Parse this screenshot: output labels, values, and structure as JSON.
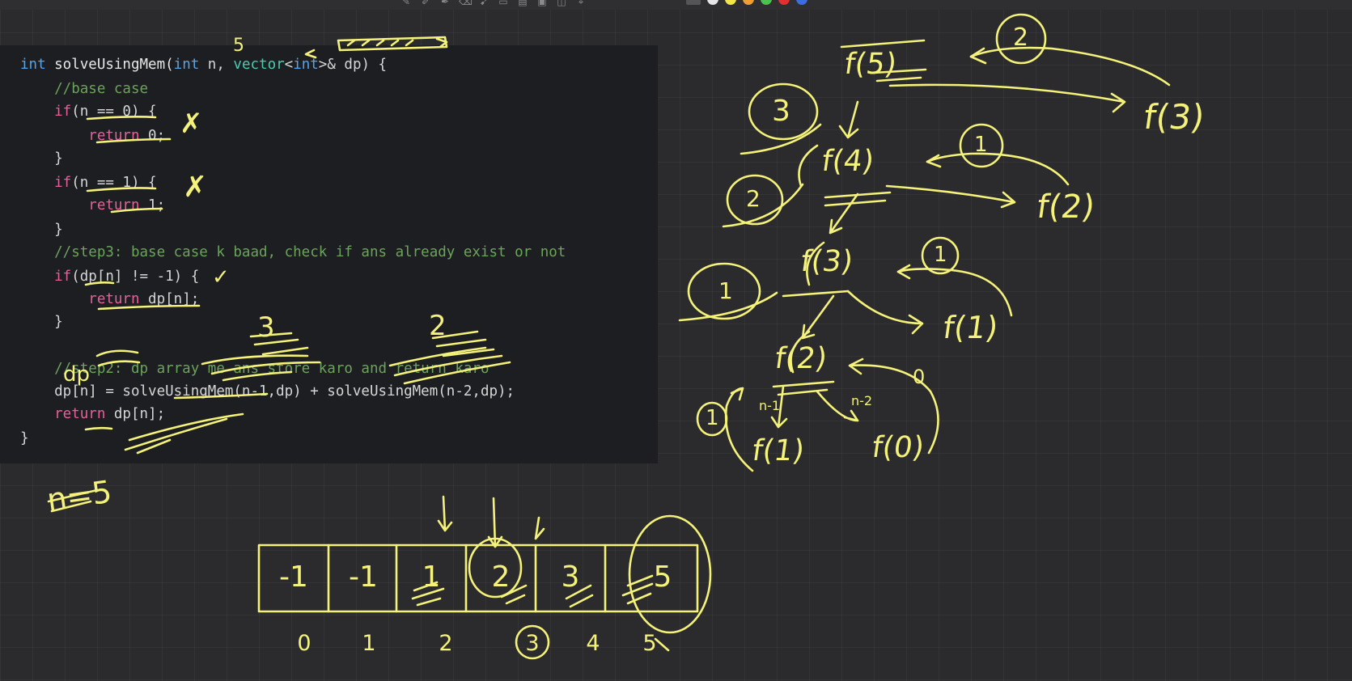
{
  "code": {
    "lines": [
      {
        "parts": [
          {
            "cls": "kw",
            "t": "int"
          },
          {
            "cls": "fn",
            "t": " solveUsingMem("
          },
          {
            "cls": "kw",
            "t": "int"
          },
          {
            "cls": "punc",
            "t": " n, "
          },
          {
            "cls": "typ",
            "t": "vector"
          },
          {
            "cls": "punc",
            "t": "<"
          },
          {
            "cls": "kw",
            "t": "int"
          },
          {
            "cls": "punc",
            "t": ">& dp) {"
          }
        ]
      },
      {
        "parts": [
          {
            "cls": "cm",
            "t": "    //base case"
          }
        ]
      },
      {
        "parts": [
          {
            "cls": "kw2",
            "t": "    if"
          },
          {
            "cls": "punc",
            "t": "(n == 0) {"
          }
        ]
      },
      {
        "parts": [
          {
            "cls": "kw2",
            "t": "        return"
          },
          {
            "cls": "punc",
            "t": " 0;"
          }
        ]
      },
      {
        "parts": [
          {
            "cls": "punc",
            "t": "    }"
          }
        ]
      },
      {
        "parts": [
          {
            "cls": "kw2",
            "t": "    if"
          },
          {
            "cls": "punc",
            "t": "(n == 1) {"
          }
        ]
      },
      {
        "parts": [
          {
            "cls": "kw2",
            "t": "        return"
          },
          {
            "cls": "punc",
            "t": " 1;"
          }
        ]
      },
      {
        "parts": [
          {
            "cls": "punc",
            "t": "    }"
          }
        ]
      },
      {
        "parts": [
          {
            "cls": "cm",
            "t": "    //step3: base case k baad, check if ans already exist or not"
          }
        ]
      },
      {
        "parts": [
          {
            "cls": "kw2",
            "t": "    if"
          },
          {
            "cls": "punc",
            "t": "(dp[n] != -1) {"
          }
        ]
      },
      {
        "parts": [
          {
            "cls": "kw2",
            "t": "        return"
          },
          {
            "cls": "punc",
            "t": " dp[n];"
          }
        ]
      },
      {
        "parts": [
          {
            "cls": "punc",
            "t": "    }"
          }
        ]
      },
      {
        "parts": [
          {
            "cls": "punc",
            "t": ""
          }
        ]
      },
      {
        "parts": [
          {
            "cls": "cm",
            "t": "    //step2: dp array me ans store karo and return karo"
          }
        ]
      },
      {
        "parts": [
          {
            "cls": "punc",
            "t": "    dp[n] = solveUsingMem(n-1,dp) + solveUsingMem(n-2,dp);"
          }
        ]
      },
      {
        "parts": [
          {
            "cls": "kw2",
            "t": "    return"
          },
          {
            "cls": "punc",
            "t": " dp[n];"
          }
        ]
      },
      {
        "parts": [
          {
            "cls": "punc",
            "t": "}"
          }
        ]
      }
    ]
  },
  "annotations": {
    "n_label": "n=5",
    "param_note": "5",
    "dp_note": "dp",
    "crosses": [
      "✗",
      "✗"
    ],
    "check": "✓",
    "scribble_values": [
      "3",
      "2"
    ]
  },
  "tree": {
    "calls": [
      {
        "label": "f(5)",
        "name": "call-f5"
      },
      {
        "label": "f(4)",
        "name": "call-f4"
      },
      {
        "label": "f(3)",
        "name": "call-f3"
      },
      {
        "label": "f(2)",
        "name": "call-f2"
      },
      {
        "label": "f(1)",
        "name": "call-f1-left"
      },
      {
        "label": "f(0)",
        "name": "call-f0"
      },
      {
        "label": "f(3)",
        "name": "call-f3-right"
      },
      {
        "label": "f(2)",
        "name": "call-f2-right"
      },
      {
        "label": "f(1)",
        "name": "call-f1-right"
      }
    ],
    "returned_values": [
      "3",
      "2",
      "1",
      "1",
      "2",
      "1",
      "1",
      "0"
    ],
    "edge_labels": [
      "n-1",
      "n-2"
    ]
  },
  "dp_array": {
    "cells": [
      "-1",
      "-1",
      "1",
      "2",
      "3",
      "5"
    ],
    "indices": [
      "0",
      "1",
      "2",
      "3",
      "4",
      "5"
    ]
  },
  "colors": {
    "ink": "#f4f27a",
    "background": "#2b2b2d",
    "editor": "#1d1e21"
  }
}
